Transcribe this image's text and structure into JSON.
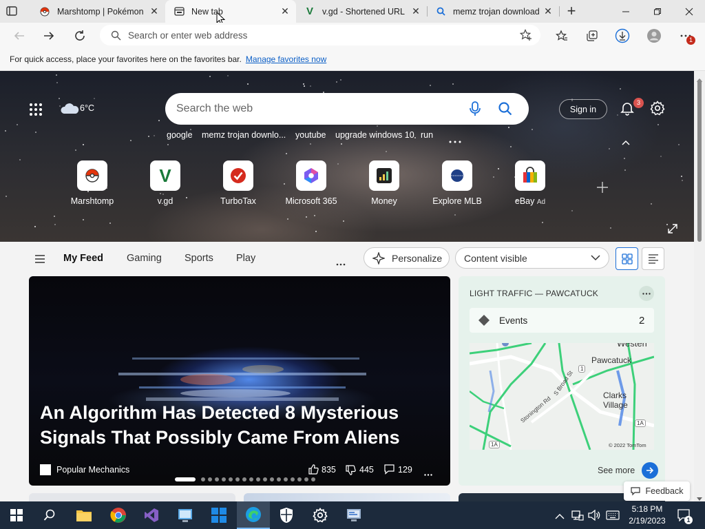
{
  "tabs": [
    {
      "title": "Marshtomp | Pokémon",
      "icon": "pokeball-icon"
    },
    {
      "title": "New tab",
      "icon": "newtab-icon",
      "active": true
    },
    {
      "title": "v.gd - Shortened URL",
      "icon": "vgd-icon"
    },
    {
      "title": "memz trojan download",
      "icon": "search-icon"
    }
  ],
  "new_tab_symbol": "+",
  "address_placeholder": "Search or enter web address",
  "favorites_bar": {
    "text": "For quick access, place your favorites here on the favorites bar.",
    "link": "Manage favorites now"
  },
  "downloads_badge": "1",
  "weather": {
    "temp": "6°C"
  },
  "search": {
    "placeholder": "Search the web"
  },
  "quick_links": [
    "google",
    "memz trojan downlo...",
    "youtube",
    "upgrade windows 10",
    "run"
  ],
  "sign_in": "Sign in",
  "notifications_count": "3",
  "tiles": [
    {
      "label": "Marshtomp"
    },
    {
      "label": "v.gd",
      "glyph": "V"
    },
    {
      "label": "TurboTax"
    },
    {
      "label": "Microsoft 365"
    },
    {
      "label": "Money"
    },
    {
      "label": "Explore MLB"
    },
    {
      "label": "eBay",
      "ad": "Ad"
    }
  ],
  "feed_nav": [
    "My Feed",
    "Gaming",
    "Sports",
    "Play"
  ],
  "personalize": "Personalize",
  "content_visible": "Content visible",
  "article": {
    "headline": "An Algorithm Has Detected 8 Mysterious Signals That Possibly Came From Aliens",
    "source": "Popular Mechanics",
    "likes": "835",
    "dislikes": "445",
    "comments": "129",
    "slide_count": 18,
    "active_slide": 1
  },
  "traffic": {
    "title": "LIGHT TRAFFIC — PAWCATUCK",
    "events_label": "Events",
    "events_count": "2",
    "map_labels": [
      "Pawcatuck",
      "Clarks",
      "Village",
      "Westerl",
      "Stonington Rd",
      "S Broad St",
      "1",
      "1A",
      "1A",
      "© 2022 TomTom"
    ],
    "see_more": "See more"
  },
  "feedback": "Feedback",
  "clock": {
    "time": "5:18 PM",
    "date": "2/19/2023"
  },
  "notification_center_count": "1"
}
